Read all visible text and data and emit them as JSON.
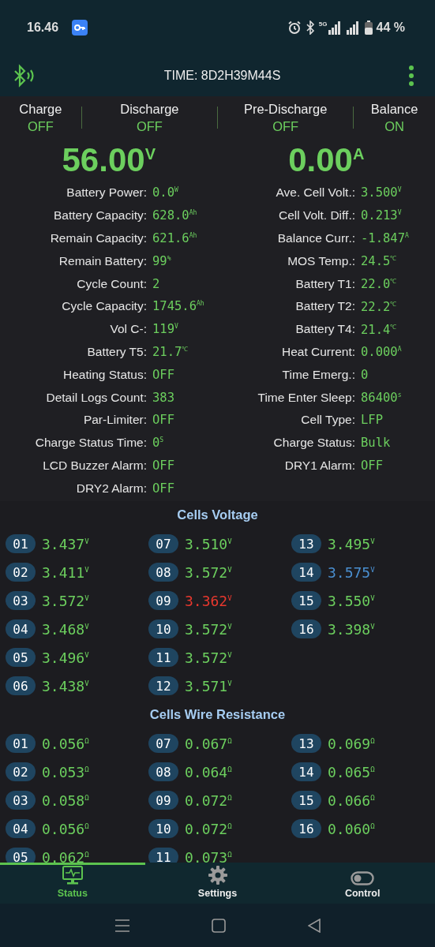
{
  "status_bar": {
    "time": "16.46",
    "network": "5G",
    "battery": "44 %"
  },
  "header": {
    "title": "TIME: 8D2H39M44S"
  },
  "switches": [
    {
      "label": "Charge",
      "value": "OFF"
    },
    {
      "label": "Discharge",
      "value": "OFF"
    },
    {
      "label": "Pre-Discharge",
      "value": "OFF"
    },
    {
      "label": "Balance",
      "value": "ON"
    }
  ],
  "readings": [
    {
      "value": "56.00$^{V}$"
    },
    {
      "value": "0.00$^{A}$"
    }
  ],
  "params_left": [
    {
      "label": "Battery Power:",
      "value": "0.0$^{W}$"
    },
    {
      "label": "Battery Capacity:",
      "value": "628.0$^{Ah}$"
    },
    {
      "label": "Remain Capacity:",
      "value": "621.6$^{Ah}$"
    },
    {
      "label": "Remain Battery:",
      "value": "99$^{%}$"
    },
    {
      "label": "Cycle Count:",
      "value": "2"
    },
    {
      "label": "Cycle Capacity:",
      "value": "1745.6$^{Ah}$"
    },
    {
      "label": "Vol C-:",
      "value": "119$^{V}$"
    },
    {
      "label": "Battery T5:",
      "value": "21.7$^{℃}$"
    },
    {
      "label": "Heating Status:",
      "value": "OFF"
    },
    {
      "label": "Detail Logs Count:",
      "value": "383"
    },
    {
      "label": "Par-Limiter:",
      "value": "OFF"
    },
    {
      "label": "Charge Status Time:",
      "value": "0$^{S}$"
    },
    {
      "label": "LCD Buzzer Alarm:",
      "value": "OFF"
    },
    {
      "label": "DRY2 Alarm:",
      "value": "OFF"
    }
  ],
  "params_right": [
    {
      "label": "Ave. Cell Volt.:",
      "value": "3.500$^{V}$"
    },
    {
      "label": "Cell Volt. Diff.:",
      "value": "0.213$^{V}$"
    },
    {
      "label": "Balance Curr.:",
      "value": "-1.847$^{A}$"
    },
    {
      "label": "MOS Temp.:",
      "value": "24.5$^{℃}$"
    },
    {
      "label": "Battery T1:",
      "value": "22.0$^{℃}$"
    },
    {
      "label": "Battery T2:",
      "value": "22.2$^{℃}$"
    },
    {
      "label": "Battery T4:",
      "value": "21.4$^{℃}$"
    },
    {
      "label": "Heat Current:",
      "value": "0.000$^{A}$"
    },
    {
      "label": "Time Emerg.:",
      "value": "0"
    },
    {
      "label": "Time Enter Sleep:",
      "value": "86400$^{s}$"
    },
    {
      "label": "Cell Type:",
      "value": "LFP"
    },
    {
      "label": "Charge Status:",
      "value": "Bulk"
    },
    {
      "label": "DRY1 Alarm:",
      "value": "OFF"
    }
  ],
  "cells_voltage": {
    "title": "Cells Voltage",
    "cells": [
      {
        "index": "01",
        "value": "3.437$^{V}$",
        "color": "#6ccf5e"
      },
      {
        "index": "02",
        "value": "3.411$^{V}$",
        "color": "#6ccf5e"
      },
      {
        "index": "03",
        "value": "3.572$^{V}$",
        "color": "#6ccf5e"
      },
      {
        "index": "04",
        "value": "3.468$^{V}$",
        "color": "#6ccf5e"
      },
      {
        "index": "05",
        "value": "3.496$^{V}$",
        "color": "#6ccf5e"
      },
      {
        "index": "06",
        "value": "3.438$^{V}$",
        "color": "#6ccf5e"
      },
      {
        "index": "07",
        "value": "3.510$^{V}$",
        "color": "#6ccf5e"
      },
      {
        "index": "08",
        "value": "3.572$^{V}$",
        "color": "#6ccf5e"
      },
      {
        "index": "09",
        "value": "3.362$^{V}$",
        "color": "#e8382e"
      },
      {
        "index": "10",
        "value": "3.572$^{V}$",
        "color": "#6ccf5e"
      },
      {
        "index": "11",
        "value": "3.572$^{V}$",
        "color": "#6ccf5e"
      },
      {
        "index": "12",
        "value": "3.571$^{V}$",
        "color": "#6ccf5e"
      },
      {
        "index": "13",
        "value": "3.495$^{V}$",
        "color": "#6ccf5e"
      },
      {
        "index": "14",
        "value": "3.575$^{V}$",
        "color": "#4a8fd0"
      },
      {
        "index": "15",
        "value": "3.550$^{V}$",
        "color": "#6ccf5e"
      },
      {
        "index": "16",
        "value": "3.398$^{V}$",
        "color": "#6ccf5e"
      }
    ]
  },
  "wire_resistance": {
    "title": "Cells Wire Resistance",
    "cells": [
      {
        "index": "01",
        "value": "0.056$^{Ω}$"
      },
      {
        "index": "02",
        "value": "0.053$^{Ω}$"
      },
      {
        "index": "03",
        "value": "0.058$^{Ω}$"
      },
      {
        "index": "04",
        "value": "0.056$^{Ω}$"
      },
      {
        "index": "05",
        "value": "0.062$^{Ω}$"
      },
      {
        "index": "07",
        "value": "0.067$^{Ω}$"
      },
      {
        "index": "08",
        "value": "0.064$^{Ω}$"
      },
      {
        "index": "09",
        "value": "0.072$^{Ω}$"
      },
      {
        "index": "10",
        "value": "0.072$^{Ω}$"
      },
      {
        "index": "11",
        "value": "0.073$^{Ω}$"
      },
      {
        "index": "13",
        "value": "0.069$^{Ω}$"
      },
      {
        "index": "14",
        "value": "0.065$^{Ω}$"
      },
      {
        "index": "15",
        "value": "0.066$^{Ω}$"
      },
      {
        "index": "16",
        "value": "0.060$^{Ω}$"
      }
    ]
  },
  "bottom_nav": [
    {
      "label": "Status",
      "kind": "monitor",
      "selected": true
    },
    {
      "label": "Settings",
      "kind": "gear",
      "selected": false
    },
    {
      "label": "Control",
      "kind": "toggle",
      "selected": false
    }
  ]
}
